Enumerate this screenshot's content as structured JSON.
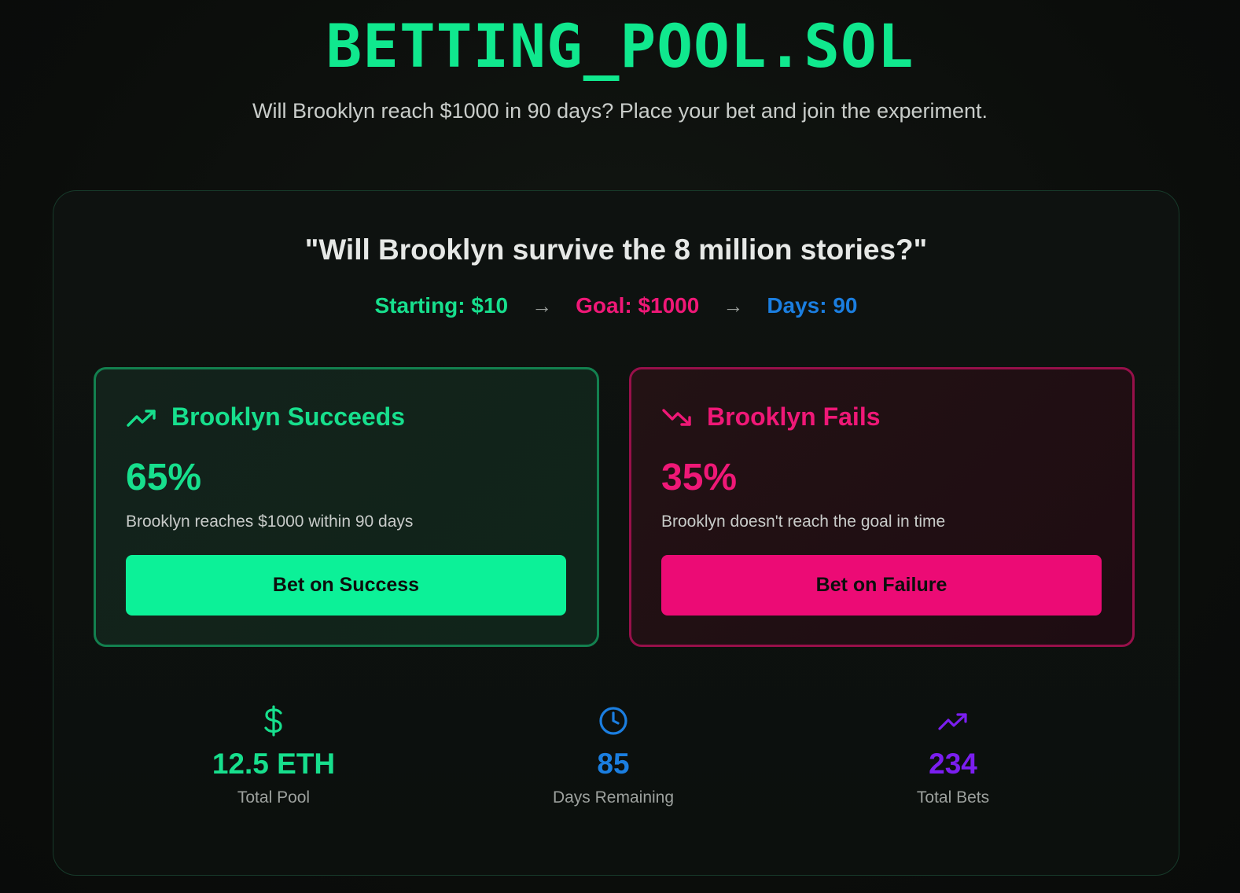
{
  "header": {
    "title": "BETTING_POOL.SOL",
    "subtitle": "Will Brooklyn reach $1000 in 90 days? Place your bet and join the experiment."
  },
  "panel": {
    "question": "\"Will Brooklyn survive the 8 million stories?\"",
    "starting": "Starting: $10",
    "goal": "Goal: $1000",
    "days": "Days: 90",
    "arrow": "→"
  },
  "cards": {
    "success": {
      "title": "Brooklyn Succeeds",
      "percent": "65%",
      "description": "Brooklyn reaches $1000 within 90 days",
      "button": "Bet on Success",
      "icon": "trending-up-icon"
    },
    "failure": {
      "title": "Brooklyn Fails",
      "percent": "35%",
      "description": "Brooklyn doesn't reach the goal in time",
      "button": "Bet on Failure",
      "icon": "trending-down-icon"
    }
  },
  "metrics": {
    "pool": {
      "value": "12.5 ETH",
      "label": "Total Pool",
      "icon": "dollar-icon"
    },
    "days": {
      "value": "85",
      "label": "Days Remaining",
      "icon": "clock-icon"
    },
    "bets": {
      "value": "234",
      "label": "Total Bets",
      "icon": "trending-up-icon"
    }
  },
  "colors": {
    "green": "#10e88e",
    "pink": "#ec0b75",
    "blue": "#1b7ee0",
    "purple": "#7b1ef0"
  }
}
